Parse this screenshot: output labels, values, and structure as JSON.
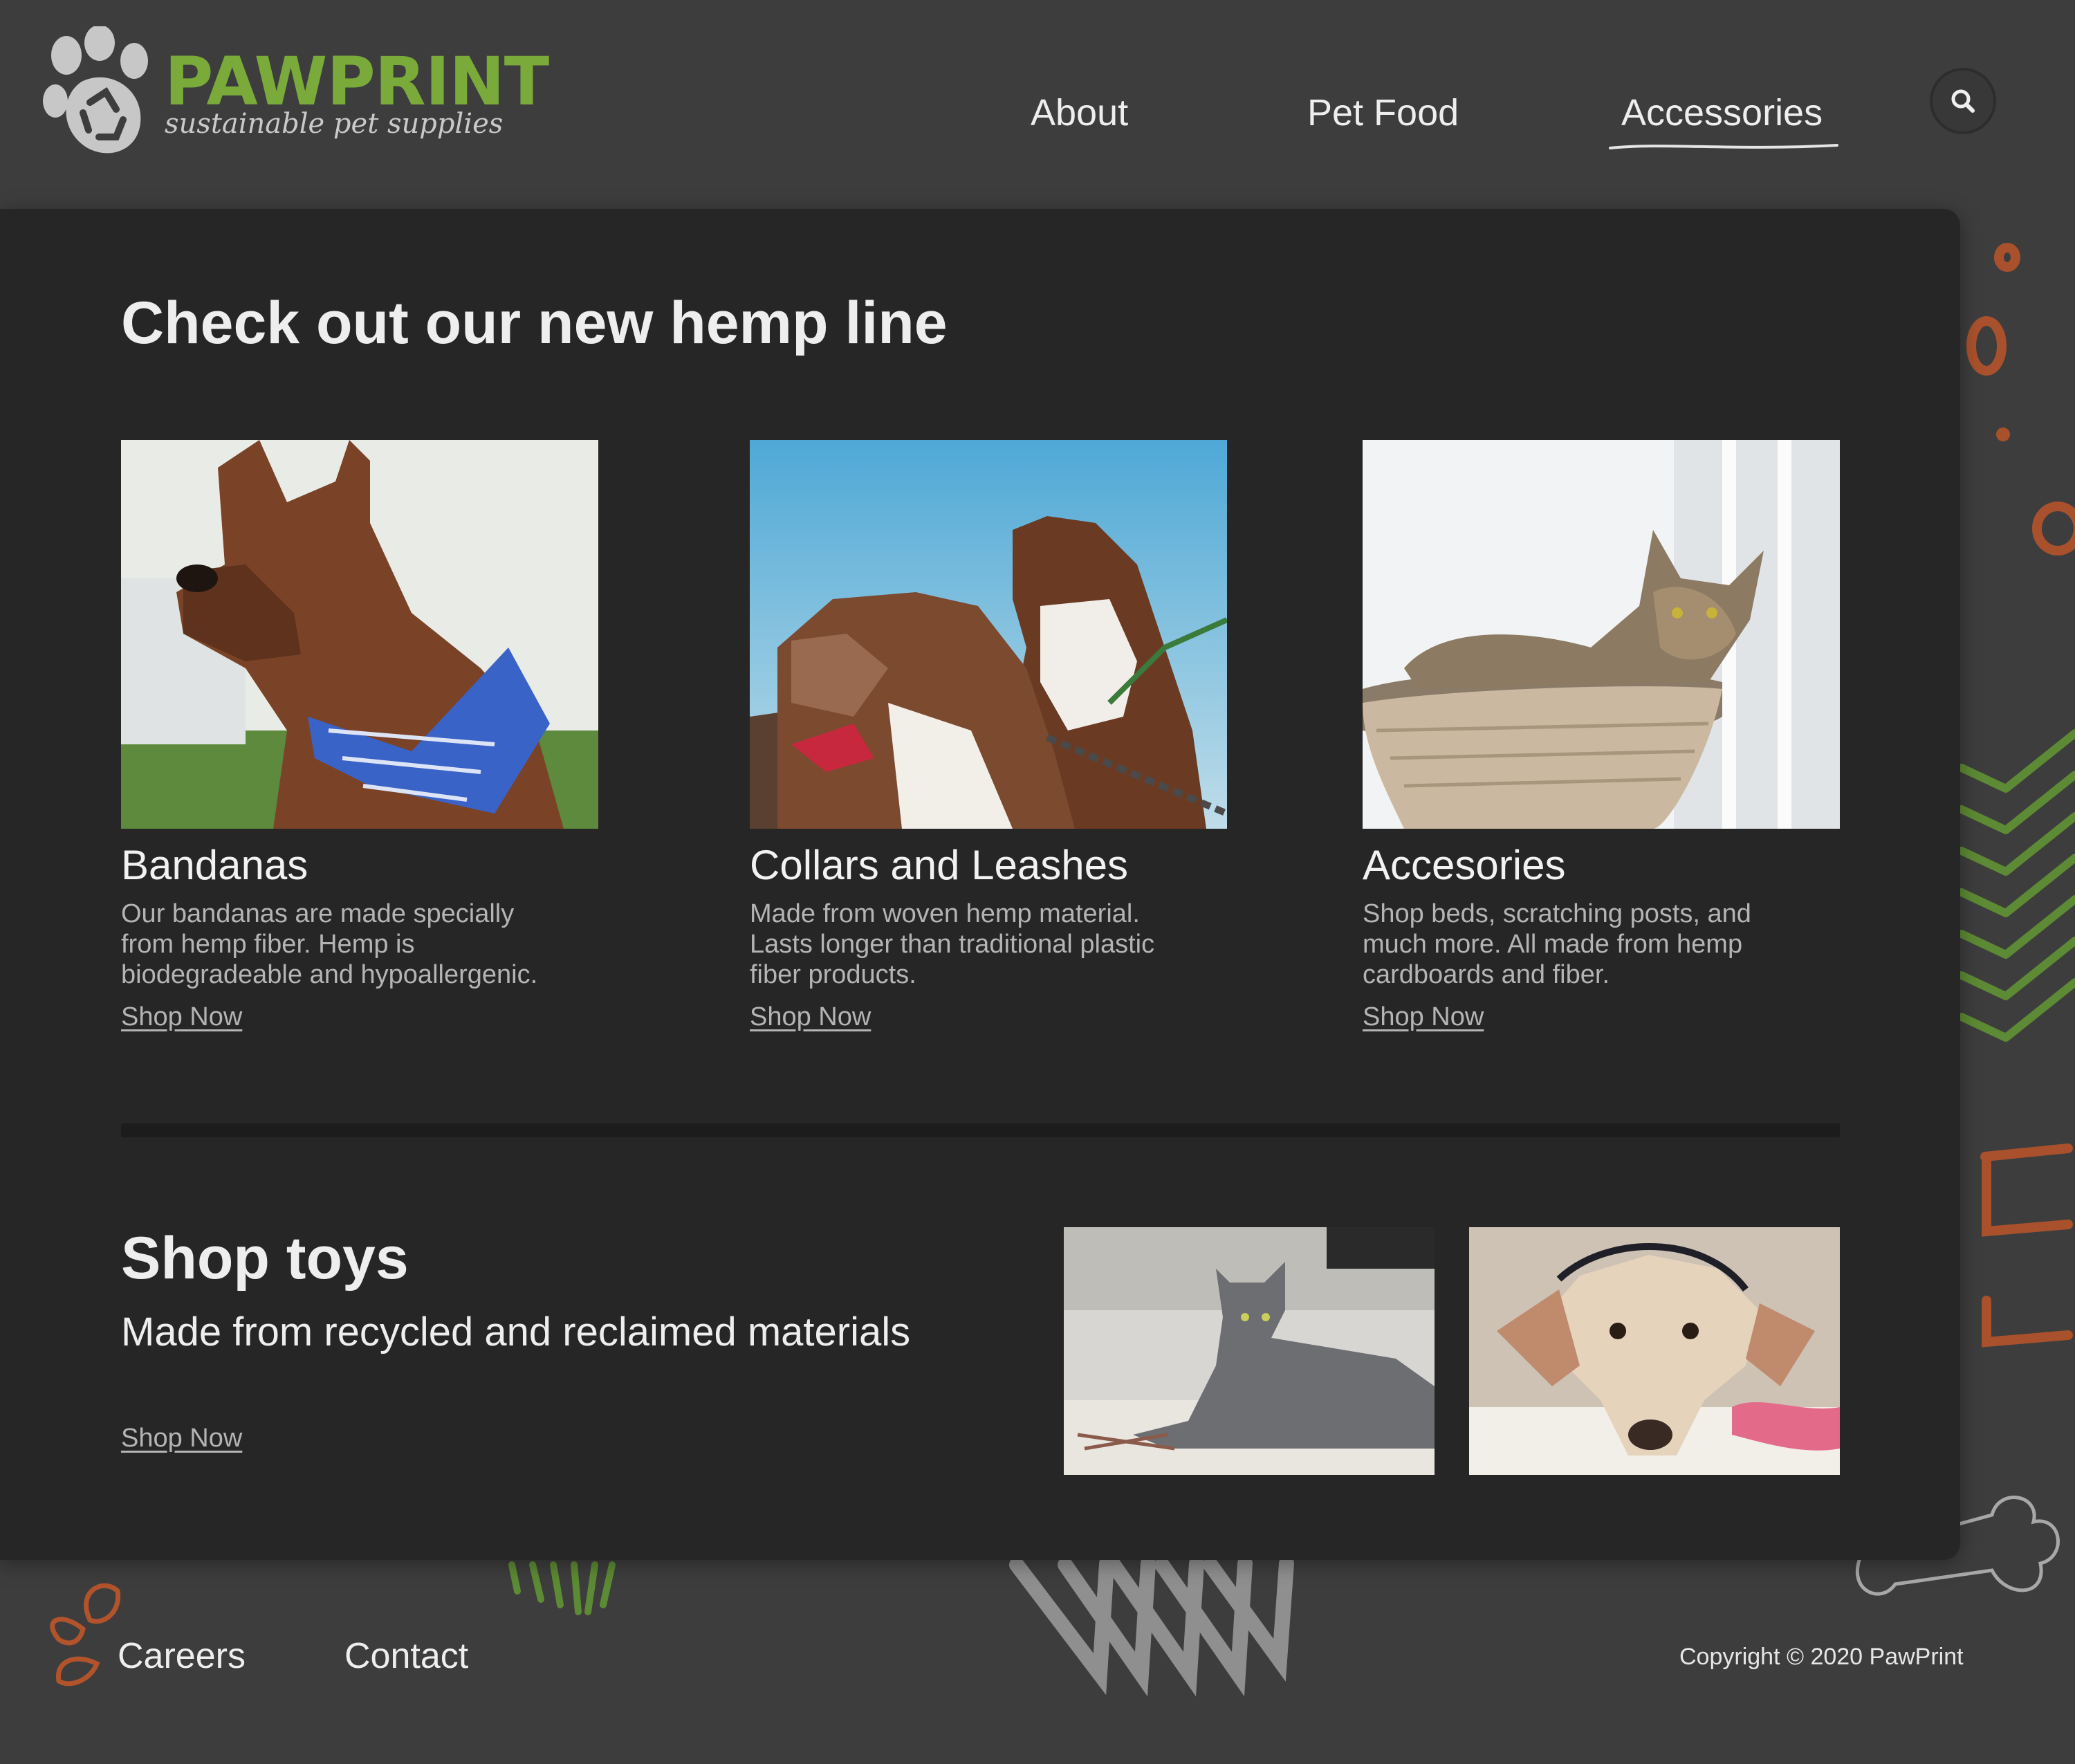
{
  "brand": {
    "name": "PAWPRINT",
    "tagline": "sustainable pet supplies"
  },
  "nav": {
    "items": [
      {
        "label": "About"
      },
      {
        "label": "Pet Food"
      },
      {
        "label": "Accessories",
        "active": true
      }
    ],
    "search_icon": "search-icon"
  },
  "hemp": {
    "title": "Check out our new hemp line",
    "products": [
      {
        "name": "Bandanas",
        "description": "Our bandanas are made specially from hemp fiber. Hemp is biodegradeable and hypoallergenic.",
        "link": "Shop Now",
        "image": "dog-with-blue-bandana"
      },
      {
        "name": "Collars and Leashes",
        "description": "Made from woven hemp material. Lasts longer than traditional plastic fiber products.",
        "link": "Shop Now",
        "image": "two-dogs-with-leashes"
      },
      {
        "name": "Accesories",
        "description": "Shop beds, scratching posts, and much more. All made from hemp cardboards and fiber.",
        "link": "Shop Now",
        "image": "cat-in-basket-bed"
      }
    ]
  },
  "toys": {
    "title": "Shop toys",
    "subtitle": "Made from recycled and reclaimed materials",
    "link": "Shop Now",
    "images": [
      "grey-cat-with-toy",
      "dog-with-rope-toy"
    ]
  },
  "footer": {
    "links": [
      "Careers",
      "Contact"
    ],
    "copyright": "Copyright © 2020 PawPrint"
  },
  "colors": {
    "background": "#3d3d3d",
    "card": "#262626",
    "brand_green": "#79aa3a",
    "accent_orange": "#b3532b",
    "text": "#eeeeee",
    "muted_text": "#b4b4b4"
  }
}
